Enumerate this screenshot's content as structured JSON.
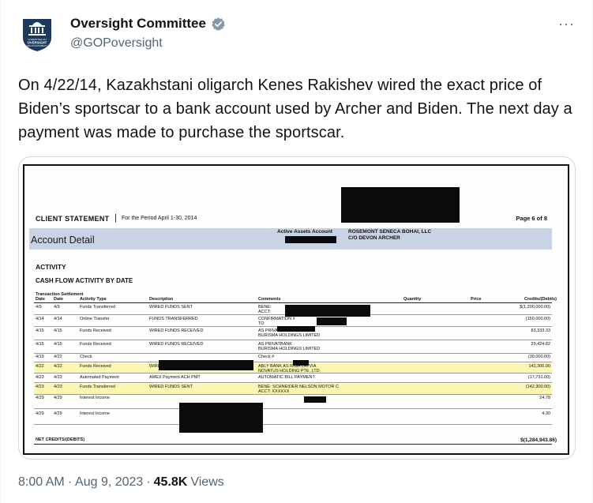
{
  "author": {
    "display_name": "Oversight Committee",
    "handle": "@GOPoversight",
    "avatar_text_top": "COMMITTEE ON",
    "avatar_text_mid": "OVERSIGHT",
    "avatar_text_bot": "AND ACCOUNTABILITY",
    "more_label": "···"
  },
  "tweet": {
    "text": "On 4/22/14, Kazakhstani oligarch Kenes Rakishev wired the exact price of Biden’s sportscar to a bank account used by Archer and Biden. The next day a payment was made to purchase the sportscar."
  },
  "document": {
    "title": "CLIENT STATEMENT",
    "separator": "|",
    "period": "For the Period April 1-30, 2014",
    "page": "Page 6 of 8",
    "account_detail": "Account Detail",
    "active_assets_label": "Active Assets Account",
    "account_name_1": "ROSEMONT SENECA BOHAI, LLC",
    "account_name_2": "C/O DEVON ARCHER",
    "activity": "ACTIVITY",
    "cash_flow": "CASH FLOW ACTIVITY BY DATE",
    "headers": {
      "txn_settle": "Transaction Settlement",
      "date1": "Date",
      "date2": "Date",
      "type": "Activity Type",
      "desc": "Description",
      "comments": "Comments",
      "quantity": "Quantity",
      "price": "Price",
      "credits": "Credits/(Debits)"
    },
    "rows": [
      {
        "d1": "4/9",
        "d2": "4/9",
        "type": "Funds Transferred",
        "desc": "WIRED FUNDS SENT",
        "com1": "BENE:",
        "com2": "ACCT:",
        "amt": "$(1,200,000.00)",
        "hl": false
      },
      {
        "d1": "4/14",
        "d2": "4/14",
        "type": "Online Transfer",
        "desc": "FUNDS TRANSFERRED",
        "com1": "CONFIRMATION #",
        "com2": "TO",
        "amt": "(150,000.00)",
        "hl": false
      },
      {
        "d1": "4/15",
        "d2": "4/15",
        "type": "Funds Received",
        "desc": "WIRED FUNDS RECEIVED",
        "com1": "AS PRIVATBANK",
        "com2": "BURISMA HOLDINGS LIMITED",
        "amt": "83,333.33",
        "hl": false
      },
      {
        "d1": "4/15",
        "d2": "4/15",
        "type": "Funds Received",
        "desc": "WIRED FUNDS RECEIVED",
        "com1": "AS PRIVATBANK",
        "com2": "BURISMA HOLDINGS LIMITED",
        "amt": "29,424.82",
        "hl": false
      },
      {
        "d1": "4/19",
        "d2": "4/22",
        "type": "Check",
        "desc": "",
        "com1": "Check #",
        "com2": "",
        "amt": "(30,000.00)",
        "hl": false
      },
      {
        "d1": "4/22",
        "d2": "4/22",
        "type": "Funds Received",
        "desc": "WIRED FUNDS RECEIVED",
        "com1": "ABLY BANK AS RIGA LATVIA",
        "com2": "NOVATUS HOLDING PTE. LTD.",
        "amt": "142,300.00",
        "hl": true
      },
      {
        "d1": "4/23",
        "d2": "4/23",
        "type": "Automated Payment",
        "desc": "AMEX Payment    ACH PMT",
        "com1": "AUTOMATIC BILL PAYMENT",
        "com2": "",
        "amt": "(17,731.00)",
        "hl": false
      },
      {
        "d1": "4/23",
        "d2": "4/23",
        "type": "Funds Transferred",
        "desc": "WIRED FUNDS SENT",
        "com1": "BENE: SCHNEIDER NELSON MOTOR C",
        "com2": "ACCT: XXXXXX",
        "amt": "(142,300.00)",
        "hl": true
      },
      {
        "d1": "4/29",
        "d2": "4/29",
        "type": "Interest Income",
        "desc": "",
        "com1": "",
        "com2": "",
        "amt": "24.78",
        "hl": false
      },
      {
        "d1": "4/29",
        "d2": "4/29",
        "type": "Interest Income",
        "desc": "",
        "com1": "",
        "com2": "",
        "amt": "4.30",
        "hl": false
      }
    ],
    "net_label": "NET CREDITS/(DEBITS)",
    "net_amount": "$(1,284,943.86)"
  },
  "meta": {
    "time": "8:00 AM",
    "sep1": "·",
    "date": "Aug 9, 2023",
    "sep2": "·",
    "views": "45.8K",
    "views_label": "Views"
  },
  "colors": {
    "verified": "#829aab",
    "text_secondary": "#536471",
    "highlight": "#fbf7b3",
    "account_bar": "#c9d3e6"
  }
}
